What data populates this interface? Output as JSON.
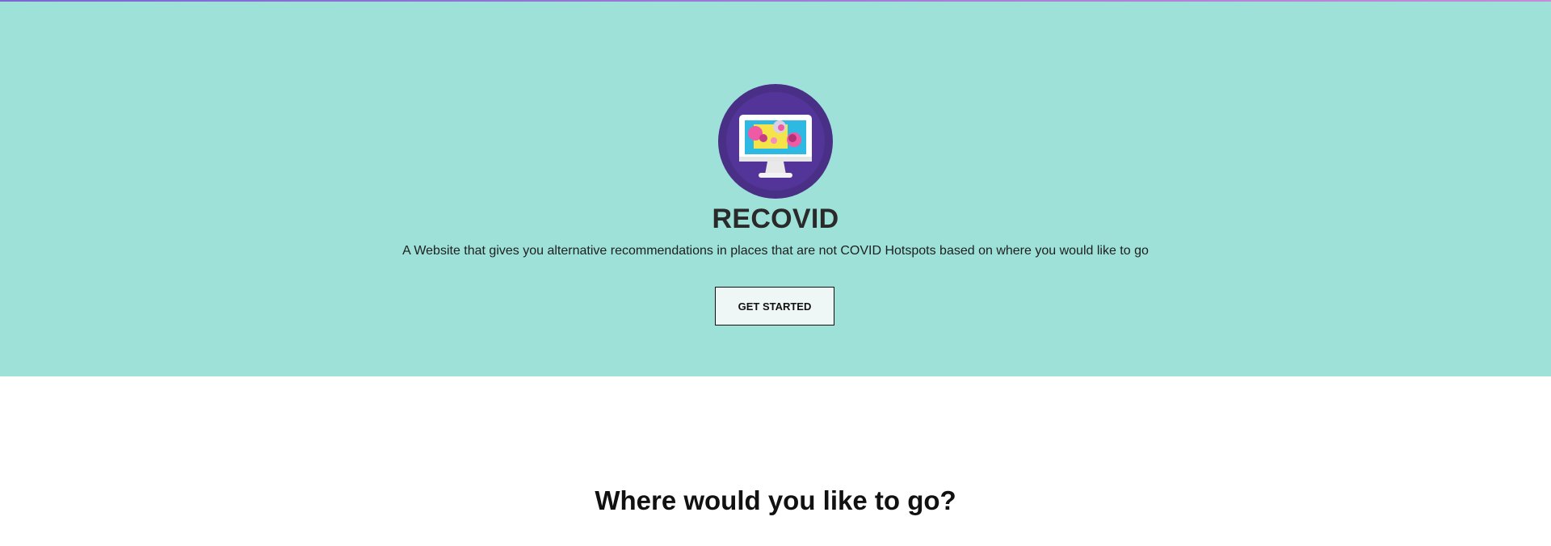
{
  "hero": {
    "background_color": "#9de1d9",
    "logo_icon": "computer-monitor-icon",
    "title": "RECOVID",
    "subtitle": "A Website that gives you alternative recommendations in places that are not COVID Hotspots based on where you would like to go",
    "cta_label": "GET STARTED"
  },
  "section": {
    "title": "Where would you like to go?"
  },
  "colors": {
    "accent_purple": "#4a2f86",
    "hero_teal": "#9de1d9"
  }
}
